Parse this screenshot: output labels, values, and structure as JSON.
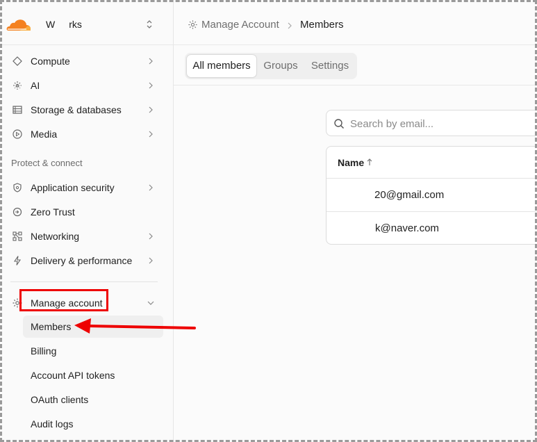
{
  "account": {
    "name_start": "W",
    "name_end": "rks"
  },
  "sidebar": {
    "items": [
      {
        "label": "Compute",
        "icon": "code-diamond-icon",
        "chevron": true
      },
      {
        "label": "AI",
        "icon": "sparkle-icon",
        "chevron": true
      },
      {
        "label": "Storage & databases",
        "icon": "database-icon",
        "chevron": true
      },
      {
        "label": "Media",
        "icon": "play-circle-icon",
        "chevron": true
      }
    ],
    "section_label": "Protect & connect",
    "protect_items": [
      {
        "label": "Application security",
        "icon": "shield-icon",
        "chevron": true
      },
      {
        "label": "Zero Trust",
        "icon": "zero-trust-icon",
        "chevron": false
      },
      {
        "label": "Networking",
        "icon": "network-icon",
        "chevron": true
      },
      {
        "label": "Delivery & performance",
        "icon": "lightning-icon",
        "chevron": true
      }
    ],
    "manage": {
      "label": "Manage account",
      "icon": "gear-icon"
    },
    "sub_items": [
      {
        "label": "Members"
      },
      {
        "label": "Billing"
      },
      {
        "label": "Account API tokens"
      },
      {
        "label": "OAuth clients"
      },
      {
        "label": "Audit logs"
      }
    ]
  },
  "breadcrumb": {
    "parent": "Manage Account",
    "current": "Members"
  },
  "tabs": [
    {
      "label": "All members",
      "active": true
    },
    {
      "label": "Groups",
      "active": false
    },
    {
      "label": "Settings",
      "active": false
    }
  ],
  "search": {
    "placeholder": "Search by email..."
  },
  "table": {
    "header": "Name",
    "rows": [
      {
        "email": "20@gmail.com"
      },
      {
        "email": "k@naver.com"
      }
    ]
  },
  "colors": {
    "accent": "#f48120",
    "annotation": "#ee0000"
  }
}
